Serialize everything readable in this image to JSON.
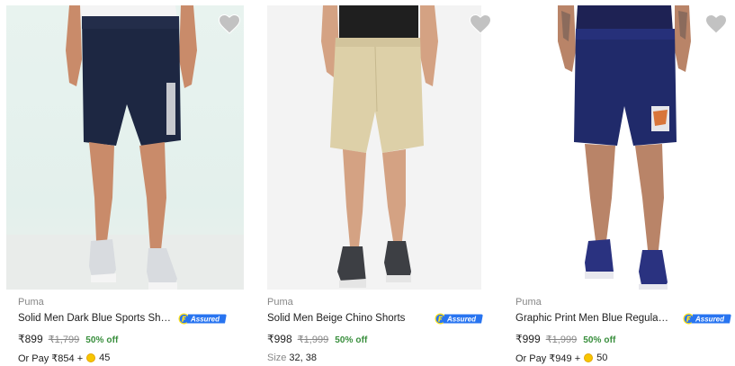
{
  "products": [
    {
      "brand": "Puma",
      "title": "Solid Men Dark Blue Sports Shorts",
      "price": "₹899",
      "mrp": "₹1,799",
      "discount": "50% off",
      "extra_prefix": "Or Pay ₹854 +",
      "extra_coins": "45",
      "assured_label": "Assured",
      "icon": "heart-icon"
    },
    {
      "brand": "Puma",
      "title": "Solid Men Beige Chino Shorts",
      "price": "₹998",
      "mrp": "₹1,999",
      "discount": "50% off",
      "size_label": "Size",
      "sizes": "32, 38",
      "assured_label": "Assured",
      "icon": "heart-icon"
    },
    {
      "brand": "Puma",
      "title": "Graphic Print Men Blue Regular S...",
      "price": "₹999",
      "mrp": "₹1,999",
      "discount": "50% off",
      "extra_prefix": "Or Pay ₹949 +",
      "extra_coins": "50",
      "assured_label": "Assured",
      "icon": "heart-icon"
    }
  ],
  "colors": {
    "discount": "#388e3c",
    "muted": "#878787",
    "assured_blue": "#2874f0",
    "coin": "#f7c600"
  }
}
